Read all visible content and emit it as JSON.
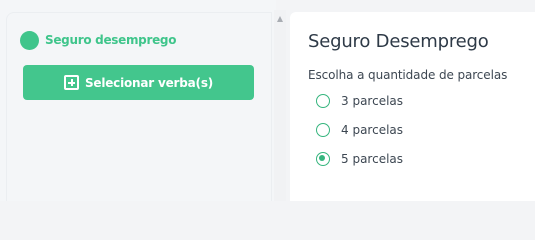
{
  "sidebar": {
    "item_label": "Seguro desemprego",
    "button_label": "Selecionar verba(s)"
  },
  "panel": {
    "title": "Seguro Desemprego",
    "question": "Escolha a quantidade de parcelas",
    "options": [
      {
        "label": "3 parcelas",
        "checked": false
      },
      {
        "label": "4 parcelas",
        "checked": false
      },
      {
        "label": "5 parcelas",
        "checked": true
      }
    ]
  },
  "colors": {
    "accent": "#43c68d",
    "accent_text": "#3fc58b",
    "radio": "#36b57e"
  },
  "icons": {
    "nav_status": "status-dot-icon",
    "button": "plus-square-icon",
    "scroll_up": "scroll-up-arrow-icon"
  }
}
